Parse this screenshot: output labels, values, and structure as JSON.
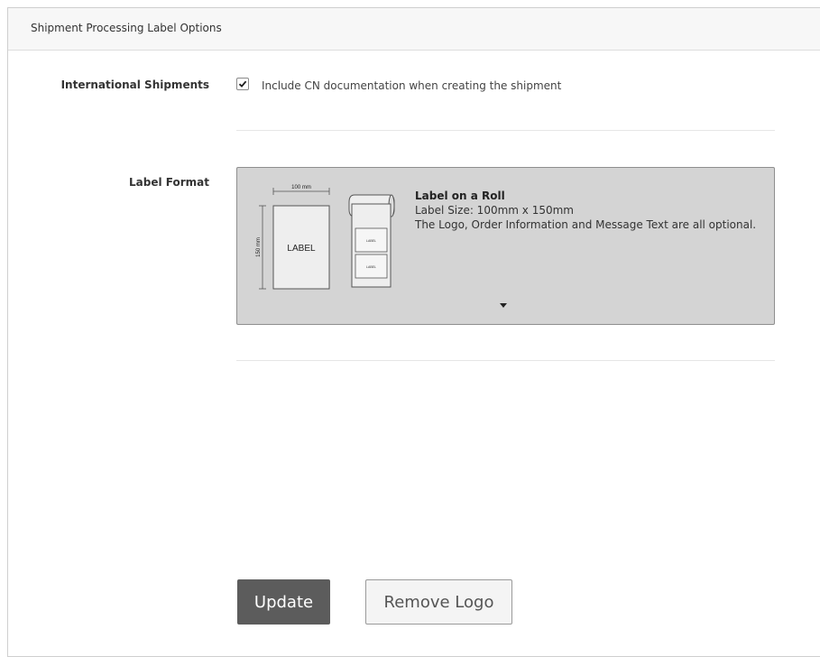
{
  "panel": {
    "title": "Shipment Processing Label Options"
  },
  "international": {
    "label": "International Shipments",
    "checkbox_checked": true,
    "checkbox_text": "Include CN documentation when creating the shipment"
  },
  "label_format": {
    "label": "Label Format",
    "selected": {
      "title": "Label on a Roll",
      "size": "Label Size: 100mm x 150mm",
      "description": "The Logo, Order Information and Message Text are all optional.",
      "illustration": {
        "width_dim": "100 mm",
        "height_dim": "150 mm",
        "label_text": "LABEL",
        "roll_label_text": "LABEL"
      }
    },
    "dropdown_icon": "caret-down-icon"
  },
  "buttons": {
    "update": "Update",
    "remove_logo": "Remove Logo"
  },
  "colors": {
    "update_bg": "#5c5c5c",
    "option_bg": "#d4d4d4",
    "header_bg": "#f7f7f7"
  }
}
